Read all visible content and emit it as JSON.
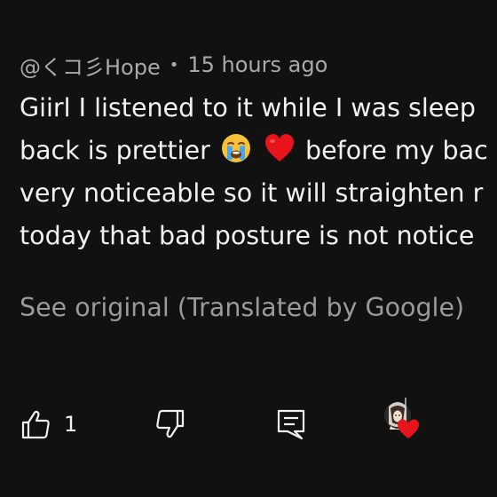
{
  "comment": {
    "author": "@くコ彡Hope",
    "separator": "•",
    "timestamp": "15 hours ago",
    "lines": [
      {
        "before": "Giirl I listened to it while I was sleep",
        "after": ""
      },
      {
        "before": "back is prettier ",
        "after": " before my bac"
      },
      {
        "before": "very noticeable so it will straighten r",
        "after": ""
      },
      {
        "before": "today that bad posture is not notice",
        "after": ""
      }
    ],
    "see_original": "See original (Translated by Google)"
  },
  "actions": {
    "like_count": "1",
    "icons": [
      "thumbs-up-icon",
      "thumbs-down-icon",
      "reply-icon",
      "creator-heart-icon"
    ]
  },
  "colors": {
    "background": "#111111",
    "text": "#f1f1f1",
    "meta": "#aaaaaa",
    "muted": "#9a9a9a",
    "heart": "#e8141b"
  }
}
